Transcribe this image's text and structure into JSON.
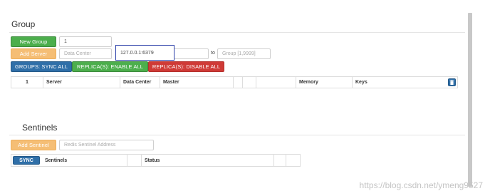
{
  "group": {
    "title": "Group",
    "new_group_label": "New Group",
    "group_id_value": "1",
    "add_server_label": "Add Server",
    "data_center_placeholder": "Data Center",
    "server_address_value": "127.0.0.1:6379",
    "to_label": "to",
    "group_range_placeholder": "Group [1,9999]",
    "sync_all_label": "GROUPS: SYNC ALL",
    "enable_all_label": "REPLICA(S): ENABLE ALL",
    "disable_all_label": "REPLICA(S): DISABLE ALL",
    "table_headers": [
      "1",
      "Server",
      "Data Center",
      "Master",
      "",
      "",
      "",
      "Memory",
      "Keys"
    ],
    "trash_icon": "trash-icon"
  },
  "sentinels": {
    "title": "Sentinels",
    "add_sentinel_label": "Add Sentinel",
    "sentinel_address_placeholder": "Redis Sentinel Address",
    "sync_label": "SYNC",
    "table_headers": [
      "Sentinels",
      "",
      "Status",
      "",
      ""
    ]
  },
  "watermark": "https://blog.csdn.net/ymeng9527",
  "colors": {
    "green": "#4cae4c",
    "orange": "#f5be75",
    "blue": "#2f6fa8",
    "red": "#cf3a36",
    "focus": "#2b3fa8"
  }
}
